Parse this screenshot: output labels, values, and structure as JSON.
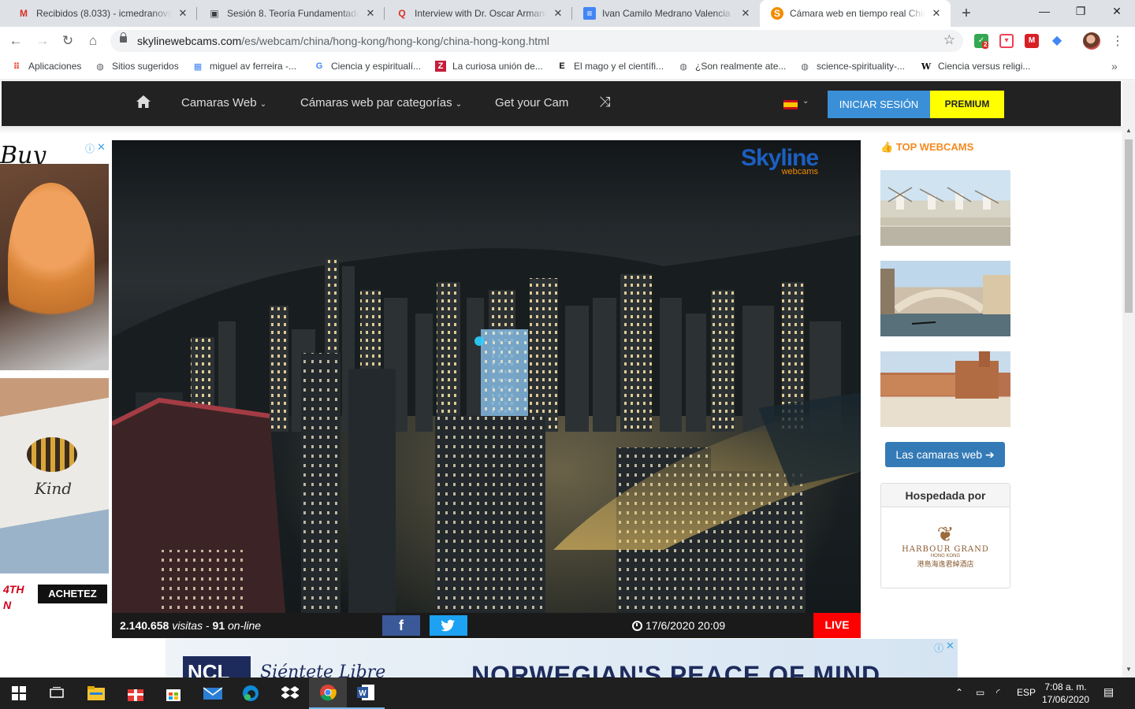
{
  "browser": {
    "tabs": [
      {
        "title": "Recibidos (8.033) - icmedranov@",
        "icon": "gmail-icon",
        "color": "#d93025",
        "glyph": "M"
      },
      {
        "title": "Sesión 8. Teoría Fundamentada (",
        "icon": "document-icon",
        "color": "#3c4043",
        "glyph": "▣"
      },
      {
        "title": "Interview with Dr. Oscar Armand",
        "icon": "quora-icon",
        "color": "#d93025",
        "glyph": "Q"
      },
      {
        "title": "Ivan Camilo Medrano Valencia -",
        "icon": "google-docs-icon",
        "color": "#4285f4",
        "glyph": "≡"
      },
      {
        "title": "Cámara web en tiempo real Chin",
        "icon": "skyline-icon",
        "color": "#f28c00",
        "glyph": "S"
      }
    ],
    "url_host": "skylinewebcams.com",
    "url_path": "/es/webcam/china/hong-kong/hong-kong/china-hong-kong.html",
    "extensions": [
      {
        "name": "shield-extension-icon",
        "color": "#34a853",
        "badge": "2"
      },
      {
        "name": "pocket-extension-icon",
        "color": "#ef4056"
      },
      {
        "name": "mendeley-extension-icon",
        "color": "#d91f26"
      },
      {
        "name": "graduation-extension-icon",
        "color": "#4285f4"
      }
    ],
    "bookmarks": [
      {
        "label": "Aplicaciones",
        "icon": "apps-grid-icon",
        "color": "#ea4335",
        "glyph": "⠿"
      },
      {
        "label": "Sitios sugeridos",
        "icon": "globe-icon",
        "color": "#5f6368",
        "glyph": "◍"
      },
      {
        "label": "miguel av ferreira -...",
        "icon": "bookmark-site-icon",
        "color": "#4285f4",
        "glyph": "▦"
      },
      {
        "label": "Ciencia y espiritualí...",
        "icon": "google-icon",
        "color": "#4285f4",
        "glyph": "G"
      },
      {
        "label": "La curiosa unión de...",
        "icon": "z-site-icon",
        "color": "#c41e3a",
        "glyph": "Z"
      },
      {
        "label": "El mago y el científi...",
        "icon": "e-site-icon",
        "color": "#111111",
        "glyph": "E"
      },
      {
        "label": "¿Son realmente ate...",
        "icon": "globe-icon",
        "color": "#5f6368",
        "glyph": "◍"
      },
      {
        "label": "science-spirituality-...",
        "icon": "globe-icon",
        "color": "#5f6368",
        "glyph": "◍"
      },
      {
        "label": "Ciencia versus religi...",
        "icon": "wikipedia-icon",
        "color": "#111111",
        "glyph": "W"
      }
    ]
  },
  "site": {
    "nav": {
      "cams": "Camaras Web",
      "categories": "Cámaras web par categorías",
      "getcam": "Get your Cam",
      "login": "INICIAR SESIÓN",
      "premium": "PREMIUM"
    },
    "left_ad": {
      "headline": "Buy",
      "side_text": "4TH\nN",
      "button": "ACHETEZ",
      "shirt2_word": "Kind"
    },
    "video": {
      "watermark_top": "Skyline",
      "watermark_bottom": "webcams",
      "visits_num": "2.140.658",
      "visits_word": "visitas",
      "online_num": "91",
      "online_word": "on-line",
      "timestamp": "17/6/2020 20:09",
      "live": "LIVE"
    },
    "sidebar": {
      "title": "TOP WEBCAMS",
      "button": "Las camaras web",
      "hosted_by": "Hospedada por",
      "hotel_name": "HARBOUR GRAND",
      "hotel_sub": "HONG KONG",
      "hotel_cn": "港島海逸君綽酒店"
    },
    "bottom_ad": {
      "brand": "NCL",
      "tagline": "Siéntete Libre",
      "headline": "NORWEGIAN'S PEACE OF MIND"
    }
  },
  "taskbar": {
    "apps": [
      {
        "name": "task-view-icon"
      },
      {
        "name": "file-explorer-icon"
      },
      {
        "name": "gift-app-icon"
      },
      {
        "name": "store-icon"
      },
      {
        "name": "mail-icon"
      },
      {
        "name": "edge-icon"
      },
      {
        "name": "dropbox-icon"
      },
      {
        "name": "chrome-icon"
      },
      {
        "name": "word-icon"
      }
    ],
    "lang": "ESP",
    "time": "7:08 a. m.",
    "date": "17/06/2020"
  }
}
